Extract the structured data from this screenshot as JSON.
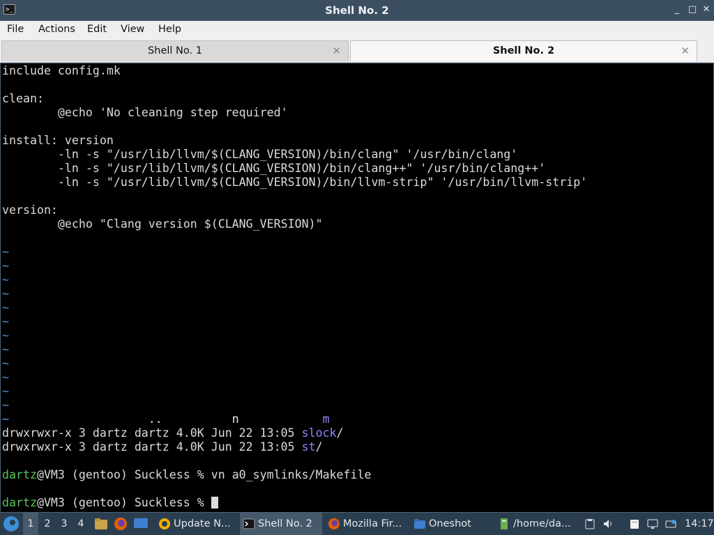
{
  "window": {
    "title": "Shell No. 2",
    "minimize": "_",
    "maximize": "□",
    "close": "✕"
  },
  "menu": [
    "File",
    "Actions",
    "Edit",
    "View",
    "Help"
  ],
  "tabs": [
    {
      "label": "Shell No. 1",
      "close": "✕"
    },
    {
      "label": "Shell No. 2",
      "close": "✕"
    }
  ],
  "terminal": {
    "lines": [
      "include config.mk",
      "",
      "clean:",
      "        @echo 'No cleaning step required'",
      "",
      "install: version",
      "        -ln -s \"/usr/lib/llvm/$(CLANG_VERSION)/bin/clang\" '/usr/bin/clang'",
      "        -ln -s \"/usr/lib/llvm/$(CLANG_VERSION)/bin/clang++\" '/usr/bin/clang++'",
      "        -ln -s \"/usr/lib/llvm/$(CLANG_VERSION)/bin/llvm-strip\" '/usr/bin/llvm-strip'",
      "",
      "version:",
      "        @echo \"Clang version $(CLANG_VERSION)\""
    ],
    "tilde": "~",
    "tilde_count": 13,
    "overlay_line": {
      "a": "                    ..",
      "b": "          n",
      "c": "            m"
    },
    "ls_rows": [
      {
        "perm": "drwxrwxr-x 3 dartz dartz 4.0K Jun 22 13:05 ",
        "name": "slock",
        "suffix": "/"
      },
      {
        "perm": "drwxrwxr-x 3 dartz dartz 4.0K Jun 22 13:05 ",
        "name": "st",
        "suffix": "/"
      }
    ],
    "prompt_user": "dartz",
    "prompt_rest": "@VM3 (gentoo) Suckless % ",
    "command": "vn a0_symlinks/Makefile"
  },
  "taskbar": {
    "workspaces": [
      "1",
      "2",
      "3",
      "4"
    ],
    "tasks": [
      "Update N...",
      "Shell No. 2",
      "Mozilla Fir...",
      "Oneshot",
      "/home/da..."
    ],
    "clock": "14:17"
  },
  "colors": {
    "terminal_bg": "#000000",
    "tilde": "#4f8fd8",
    "dir": "#8d86ff",
    "user": "#58c458",
    "taskbar": "#2b3e4f"
  }
}
